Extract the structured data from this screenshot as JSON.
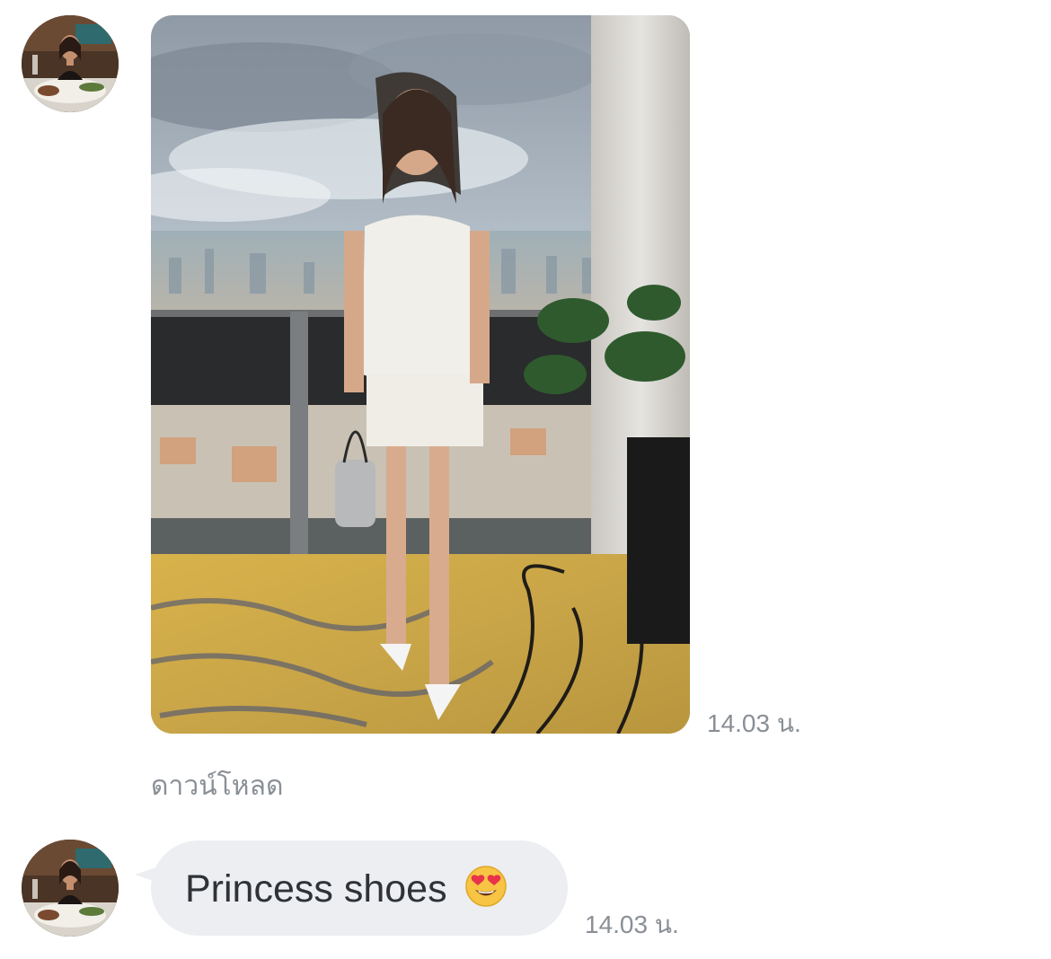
{
  "messages": [
    {
      "type": "image",
      "image_description": "photo",
      "timestamp": "14.03 น.",
      "action_label": "ดาวน์โหลด"
    },
    {
      "type": "text",
      "text": "Princess shoes",
      "emoji": "heart-eyes-emoji",
      "timestamp": "14.03 น."
    }
  ],
  "colors": {
    "bubble_background": "#eceef1",
    "text": "#2f3338",
    "muted_text": "#8a8f96"
  }
}
